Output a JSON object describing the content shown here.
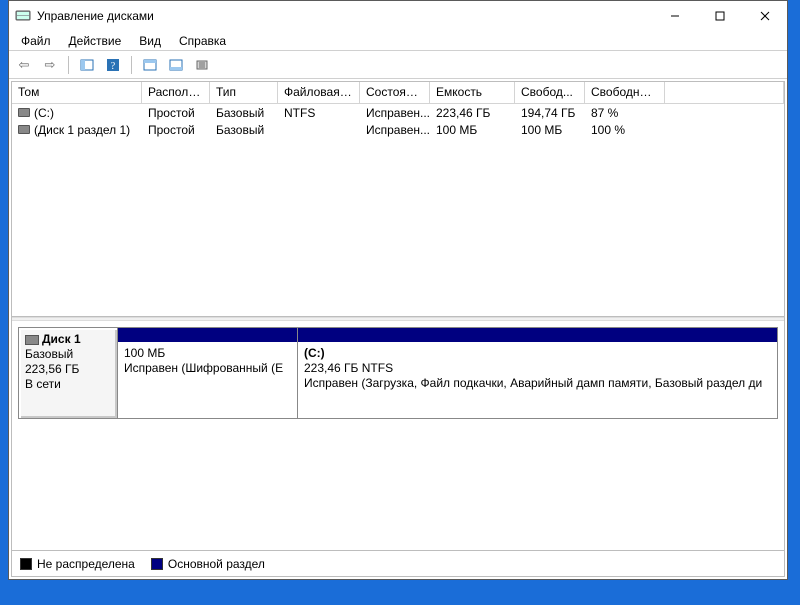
{
  "window": {
    "title": "Управление дисками"
  },
  "menu": {
    "file": "Файл",
    "action": "Действие",
    "view": "Вид",
    "help": "Справка"
  },
  "columns": {
    "volume": "Том",
    "layout": "Располо...",
    "type": "Тип",
    "fs": "Файловая с...",
    "status": "Состояние",
    "capacity": "Емкость",
    "free": "Свобод...",
    "freepct": "Свободно %"
  },
  "volumes": [
    {
      "name": "(C:)",
      "layout": "Простой",
      "type": "Базовый",
      "fs": "NTFS",
      "status": "Исправен...",
      "capacity": "223,46 ГБ",
      "free": "194,74 ГБ",
      "freepct": "87 %"
    },
    {
      "name": "(Диск 1 раздел 1)",
      "layout": "Простой",
      "type": "Базовый",
      "fs": "",
      "status": "Исправен...",
      "capacity": "100 МБ",
      "free": "100 МБ",
      "freepct": "100 %"
    }
  ],
  "disk": {
    "label_title": "Диск 1",
    "label_type": "Базовый",
    "label_size": "223,56 ГБ",
    "label_status": "В сети",
    "parts": [
      {
        "title": "",
        "size": "100 МБ",
        "status": "Исправен (Шифрованный (E"
      },
      {
        "title": "(C:)",
        "size": "223,46 ГБ NTFS",
        "status": "Исправен (Загрузка, Файл подкачки, Аварийный дамп памяти, Базовый раздел ди"
      }
    ]
  },
  "legend": {
    "unallocated": "Не распределена",
    "primary": "Основной раздел"
  },
  "icons": {
    "back": "⮜",
    "forward": "⮞",
    "up": "⤒",
    "props": "▣",
    "help": "?",
    "refresh": "⟳",
    "list": "☰",
    "detail": "▤"
  }
}
